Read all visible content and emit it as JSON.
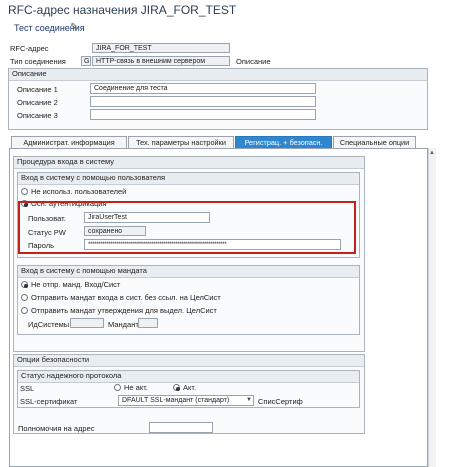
{
  "window": {
    "title": "RFC-адрес назначения JIRA_FOR_TEST"
  },
  "toolbar": {
    "test_connection": "Тест соединения"
  },
  "header": {
    "rfc_label": "RFC-адрес",
    "rfc_value": "JIRA_FOR_TEST",
    "conn_type_label": "Тип соединения",
    "conn_type_code": "G",
    "conn_type_value": "HTTP-связь в внешним сервером",
    "desc_suffix": "Описание"
  },
  "description": {
    "title": "Описание",
    "rows": [
      {
        "label": "Описание 1",
        "value": "Соединение для теста"
      },
      {
        "label": "Описание 2",
        "value": ""
      },
      {
        "label": "Описание 3",
        "value": ""
      }
    ]
  },
  "tabs": [
    {
      "label": "Администрат. информация",
      "active": false
    },
    {
      "label": "Тех. параметры настройки",
      "active": false
    },
    {
      "label": "Регистрац. + безопасн.",
      "active": true
    },
    {
      "label": "Специальные опции",
      "active": false
    }
  ],
  "logon": {
    "title": "Процедура входа в систему",
    "user_group": {
      "title": "Вход в систему с помощью пользователя",
      "opt_none": "Не использ. пользователей",
      "opt_basic": "Осн. аутентификация",
      "user_label": "Пользоват.",
      "user_value": "JiraUserTest",
      "pw_status_label": "Статус PW",
      "pw_status_value": "сохранено",
      "password_label": "Пароль",
      "password_value": "********************************************************************"
    },
    "ticket_group": {
      "title": "Вход в систему с помощью мандата",
      "opt_no": "Не отпр. манд. Вход/Сист",
      "opt_send": "Отправить мандат входа в сист. без ссыл. на ЦелСист",
      "opt_confirm": "Отправить мандат утверждения для выдел. ЦелСист",
      "sysid_label": "ИдСистемы",
      "mandt_label": "Мандант"
    }
  },
  "security": {
    "title": "Опции безопасности",
    "status_title": "Статус надежного протокола",
    "ssl_label": "SSL",
    "ssl_off": "Не акт.",
    "ssl_on": "Акт.",
    "cert_label": "SSL-сертификат",
    "cert_value": "DFAULT SSL-мандант (стандарт)",
    "cert_list": "СписСертиф",
    "authority_label": "Полномочия на адрес"
  }
}
